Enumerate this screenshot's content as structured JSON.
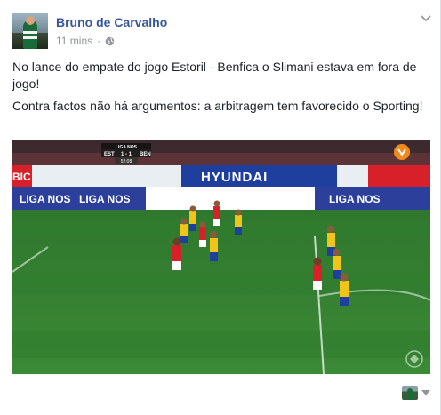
{
  "post": {
    "author": "Bruno de Carvalho",
    "time": "11 mins",
    "separator": "·",
    "privacy_icon": "globe-icon",
    "text_lines": [
      "No lance do empate do jogo Estoril - Benfica o Slimani estava em fora de jogo!",
      "Contra factos não há argumentos: a arbitragem tem favorecido o Sporting!"
    ]
  },
  "video": {
    "scoreboard": {
      "home": "EST",
      "score": "1 - 1",
      "away": "BEN",
      "clock": "52:08",
      "league": "LIGA NOS"
    },
    "ads": [
      "LIGA NOS",
      "HYUNDAI",
      "LIGA NOS",
      "LIGA NOS",
      "BIC"
    ]
  },
  "colors": {
    "author_link": "#365899",
    "meta_text": "#90949c",
    "pitch": "#2f7a2c",
    "benfica_red": "#d8202a",
    "estoril_yellow": "#f0c419",
    "ad_board_blue": "#1f3f9e"
  },
  "icons": {
    "options": "chevron-down-icon",
    "reaction_selector": "caret-down-icon"
  }
}
